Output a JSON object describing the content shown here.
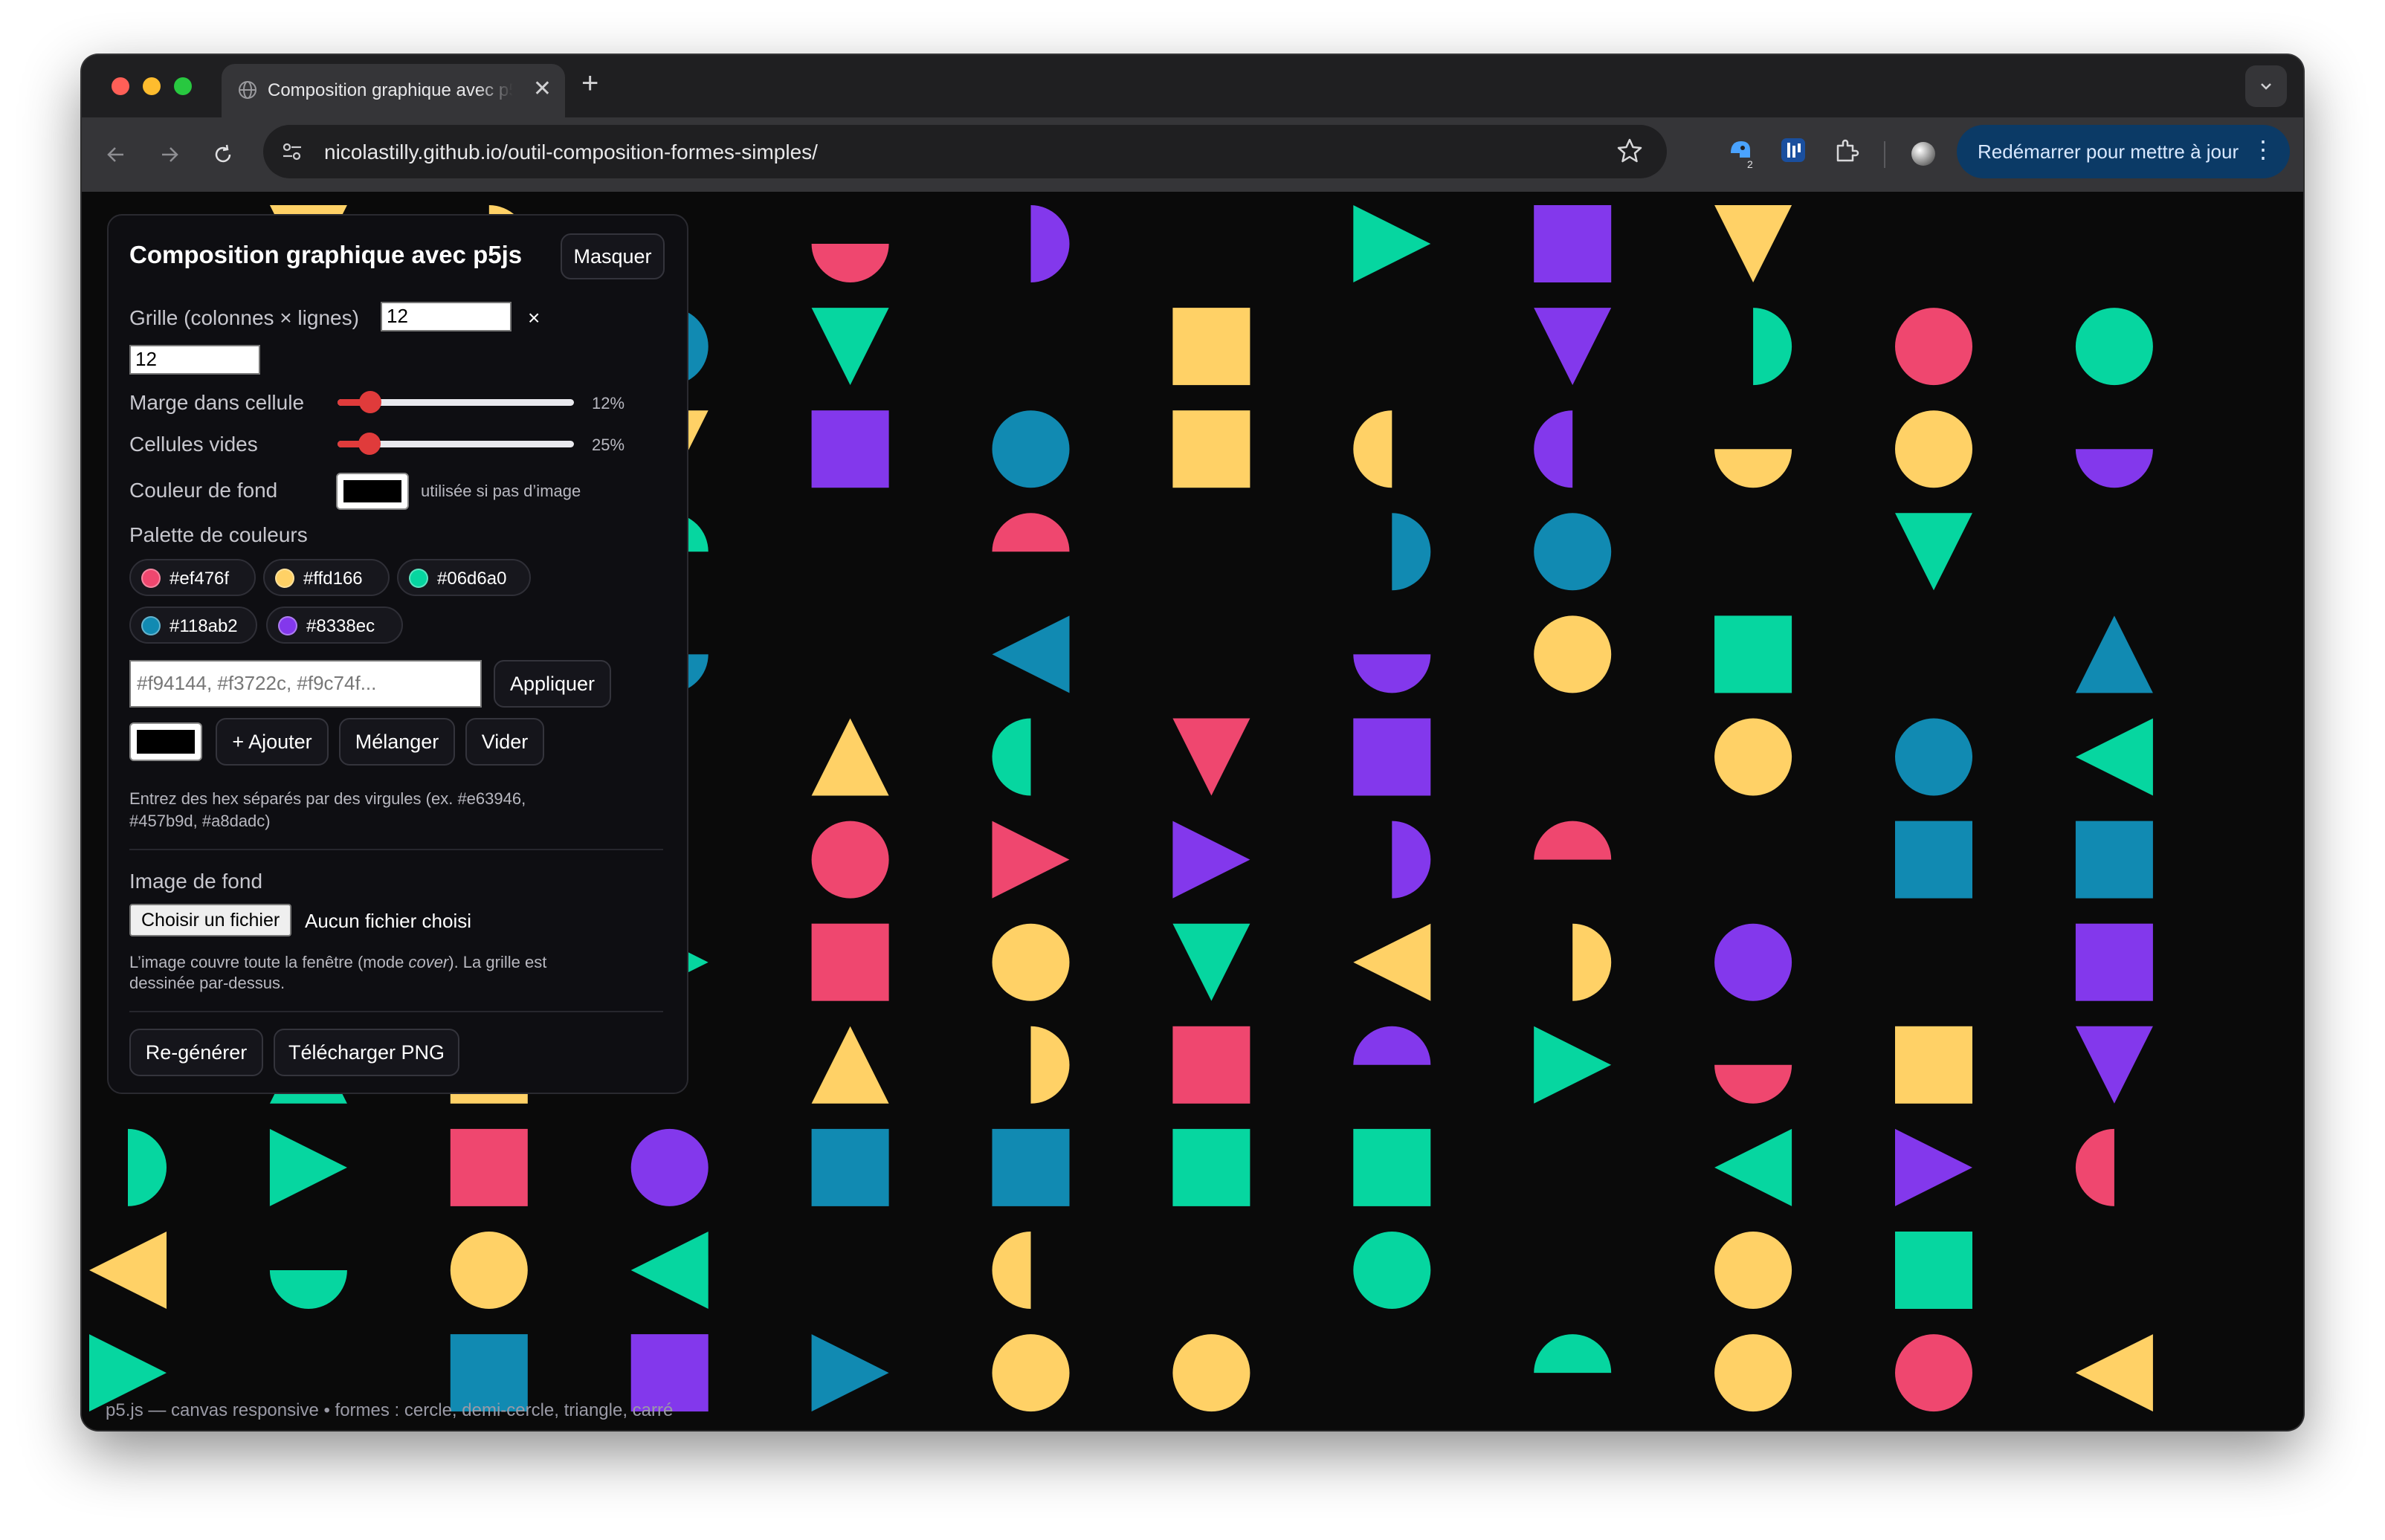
{
  "browser": {
    "tab_title": "Composition graphique avec p5js",
    "url": "nicolastilly.github.io/outil-composition-formes-simples/",
    "restart_label": "Redémarrer pour mettre à jour",
    "extension_badge": "2"
  },
  "panel": {
    "title": "Composition graphique avec p5js",
    "hide_label": "Masquer",
    "grid_label": "Grille (colonnes × lignes)",
    "grid_cols": "12",
    "grid_times": "×",
    "grid_rows": "12",
    "margin_label": "Marge dans cellule",
    "margin_value": "12%",
    "margin_fraction": 0.12,
    "empty_label": "Cellules vides",
    "empty_value": "25%",
    "empty_fraction": 0.25,
    "bg_color_label": "Couleur de fond",
    "bg_color_hint": "utilisée si pas d’image",
    "palette_label": "Palette de couleurs",
    "palette": [
      "#ef476f",
      "#ffd166",
      "#06d6a0",
      "#118ab2",
      "#8338ec"
    ],
    "palette_placeholder": "#f94144, #f3722c, #f9c74f...",
    "apply_label": "Appliquer",
    "add_label": "+ Ajouter",
    "shuffle_label": "Mélanger",
    "clear_label": "Vider",
    "palette_hint_1": "Entrez des hex séparés par des virgules (ex. #e63946,",
    "palette_hint_2": "#457b9d, #a8dadc)",
    "bg_image_label": "Image de fond",
    "choose_file_label": "Choisir un fichier",
    "no_file_label": "Aucun fichier choisi",
    "image_hint_1a": "L’image couvre toute la fenêtre (mode ",
    "image_hint_1b": "cover",
    "image_hint_1c": "). La grille est",
    "image_hint_2": "dessinée par-dessus.",
    "regenerate_label": "Re-générer",
    "download_label": "Télécharger PNG"
  },
  "footer": "p5.js — canvas responsive • formes : cercle, demi-cercle, triangle, carré",
  "colors": {
    "r": "#ef476f",
    "y": "#ffd166",
    "g": "#06d6a0",
    "b": "#118ab2",
    "p": "#8338ec",
    "background": "#0a0a0a",
    "accent": "#e03b3b"
  },
  "composition": {
    "columns": 12,
    "rows": 12,
    "note": "cells visible on screen: [column, row, shape, color, direction]",
    "cells": [
      [
        1,
        0,
        "triangle",
        "y",
        "down"
      ],
      [
        2,
        0,
        "half",
        "y",
        "right"
      ],
      [
        4,
        0,
        "half",
        "r",
        "down"
      ],
      [
        5,
        0,
        "half",
        "p",
        "right"
      ],
      [
        7,
        0,
        "triangle",
        "g",
        "right"
      ],
      [
        8,
        0,
        "square",
        "p",
        ""
      ],
      [
        9,
        0,
        "triangle",
        "y",
        "down"
      ],
      [
        3,
        1,
        "circle",
        "b",
        ""
      ],
      [
        4,
        1,
        "triangle",
        "g",
        "down"
      ],
      [
        6,
        1,
        "square",
        "y",
        ""
      ],
      [
        8,
        1,
        "triangle",
        "p",
        "down"
      ],
      [
        9,
        1,
        "half",
        "g",
        "right"
      ],
      [
        10,
        1,
        "circle",
        "r",
        ""
      ],
      [
        11,
        1,
        "circle",
        "g",
        ""
      ],
      [
        3,
        2,
        "triangle",
        "y",
        "down"
      ],
      [
        4,
        2,
        "square",
        "p",
        ""
      ],
      [
        5,
        2,
        "circle",
        "b",
        ""
      ],
      [
        6,
        2,
        "square",
        "y",
        ""
      ],
      [
        7,
        2,
        "half",
        "y",
        "left"
      ],
      [
        8,
        2,
        "half",
        "p",
        "left"
      ],
      [
        9,
        2,
        "half",
        "y",
        "down"
      ],
      [
        10,
        2,
        "circle",
        "y",
        ""
      ],
      [
        11,
        2,
        "half",
        "p",
        "down"
      ],
      [
        3,
        3,
        "half",
        "g",
        "up"
      ],
      [
        5,
        3,
        "half",
        "r",
        "up"
      ],
      [
        7,
        3,
        "half",
        "b",
        "right"
      ],
      [
        8,
        3,
        "circle",
        "b",
        ""
      ],
      [
        10,
        3,
        "triangle",
        "g",
        "down"
      ],
      [
        3,
        4,
        "half",
        "b",
        "down"
      ],
      [
        5,
        4,
        "triangle",
        "b",
        "left"
      ],
      [
        7,
        4,
        "half",
        "p",
        "down"
      ],
      [
        8,
        4,
        "circle",
        "y",
        ""
      ],
      [
        9,
        4,
        "square",
        "g",
        ""
      ],
      [
        11,
        4,
        "triangle",
        "b",
        "up"
      ],
      [
        4,
        5,
        "triangle",
        "y",
        "up"
      ],
      [
        5,
        5,
        "half",
        "g",
        "left"
      ],
      [
        6,
        5,
        "triangle",
        "r",
        "down"
      ],
      [
        7,
        5,
        "square",
        "p",
        ""
      ],
      [
        9,
        5,
        "circle",
        "y",
        ""
      ],
      [
        10,
        5,
        "circle",
        "b",
        ""
      ],
      [
        11,
        5,
        "triangle",
        "g",
        "left"
      ],
      [
        4,
        6,
        "circle",
        "r",
        ""
      ],
      [
        5,
        6,
        "triangle",
        "r",
        "right"
      ],
      [
        6,
        6,
        "triangle",
        "p",
        "right"
      ],
      [
        7,
        6,
        "half",
        "p",
        "right"
      ],
      [
        8,
        6,
        "half",
        "r",
        "up"
      ],
      [
        10,
        6,
        "square",
        "b",
        ""
      ],
      [
        11,
        6,
        "square",
        "b",
        ""
      ],
      [
        3,
        7,
        "triangle",
        "g",
        "right"
      ],
      [
        4,
        7,
        "square",
        "r",
        ""
      ],
      [
        5,
        7,
        "circle",
        "y",
        ""
      ],
      [
        6,
        7,
        "triangle",
        "g",
        "down"
      ],
      [
        7,
        7,
        "triangle",
        "y",
        "left"
      ],
      [
        8,
        7,
        "half",
        "y",
        "right"
      ],
      [
        9,
        7,
        "circle",
        "p",
        ""
      ],
      [
        11,
        7,
        "square",
        "p",
        ""
      ],
      [
        1,
        8,
        "triangle",
        "g",
        "up"
      ],
      [
        2,
        8,
        "square",
        "y",
        ""
      ],
      [
        4,
        8,
        "triangle",
        "y",
        "up"
      ],
      [
        5,
        8,
        "half",
        "y",
        "right"
      ],
      [
        6,
        8,
        "square",
        "r",
        ""
      ],
      [
        7,
        8,
        "half",
        "p",
        "up"
      ],
      [
        8,
        8,
        "triangle",
        "g",
        "right"
      ],
      [
        9,
        8,
        "half",
        "r",
        "down"
      ],
      [
        10,
        8,
        "square",
        "y",
        ""
      ],
      [
        11,
        8,
        "triangle",
        "p",
        "down"
      ],
      [
        0,
        9,
        "half",
        "g",
        "right"
      ],
      [
        1,
        9,
        "triangle",
        "g",
        "right"
      ],
      [
        2,
        9,
        "square",
        "r",
        ""
      ],
      [
        3,
        9,
        "circle",
        "p",
        ""
      ],
      [
        4,
        9,
        "square",
        "b",
        ""
      ],
      [
        5,
        9,
        "square",
        "b",
        ""
      ],
      [
        6,
        9,
        "square",
        "g",
        ""
      ],
      [
        7,
        9,
        "square",
        "g",
        ""
      ],
      [
        9,
        9,
        "triangle",
        "g",
        "left"
      ],
      [
        10,
        9,
        "triangle",
        "p",
        "right"
      ],
      [
        11,
        9,
        "half",
        "r",
        "left"
      ],
      [
        0,
        10,
        "triangle",
        "y",
        "left"
      ],
      [
        1,
        10,
        "half",
        "g",
        "down"
      ],
      [
        2,
        10,
        "circle",
        "y",
        ""
      ],
      [
        3,
        10,
        "triangle",
        "g",
        "left"
      ],
      [
        5,
        10,
        "half",
        "y",
        "left"
      ],
      [
        7,
        10,
        "circle",
        "g",
        ""
      ],
      [
        9,
        10,
        "circle",
        "y",
        ""
      ],
      [
        10,
        10,
        "square",
        "g",
        ""
      ],
      [
        0,
        11,
        "triangle",
        "g",
        "right"
      ],
      [
        2,
        11,
        "square",
        "b",
        ""
      ],
      [
        3,
        11,
        "square",
        "p",
        ""
      ],
      [
        4,
        11,
        "triangle",
        "b",
        "right"
      ],
      [
        5,
        11,
        "circle",
        "y",
        ""
      ],
      [
        6,
        11,
        "circle",
        "y",
        ""
      ],
      [
        8,
        11,
        "half",
        "g",
        "up"
      ],
      [
        9,
        11,
        "circle",
        "y",
        ""
      ],
      [
        10,
        11,
        "circle",
        "r",
        ""
      ],
      [
        11,
        11,
        "triangle",
        "y",
        "left"
      ]
    ]
  }
}
